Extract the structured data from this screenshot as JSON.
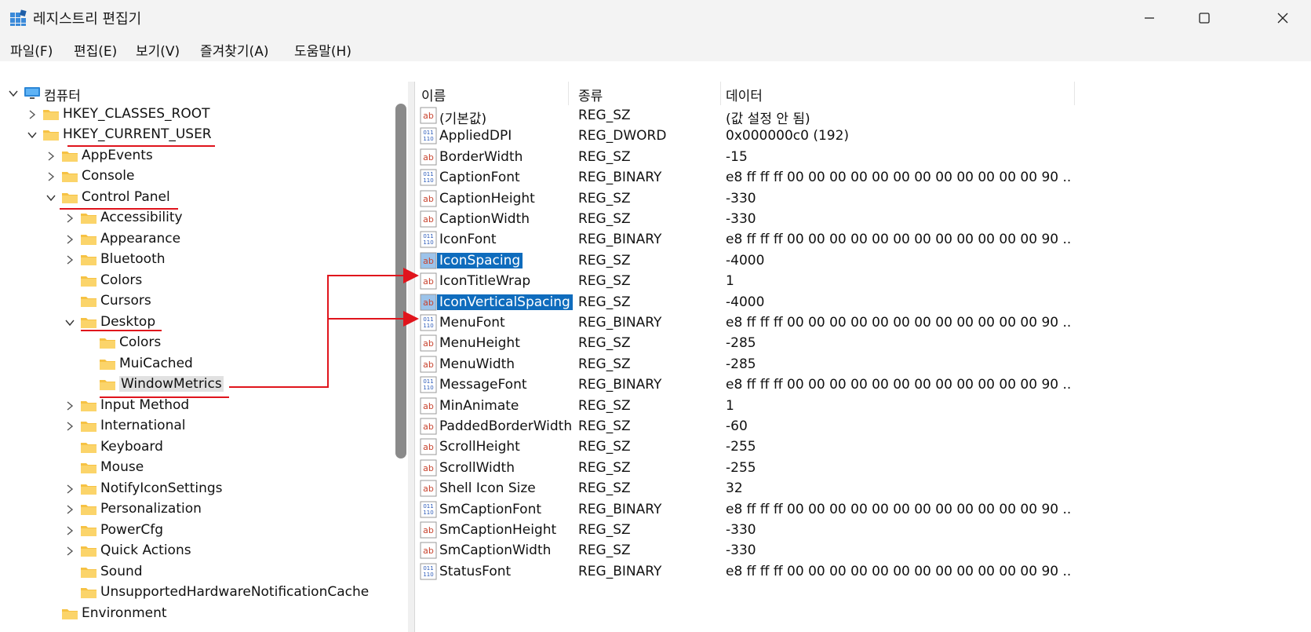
{
  "window": {
    "title": "레지스트리 편집기",
    "controls": {
      "minimize": "minimize",
      "maximize": "maximize",
      "close": "close"
    }
  },
  "menu": [
    "파일(F)",
    "편집(E)",
    "보기(V)",
    "즐겨찾기(A)",
    "도움말(H)"
  ],
  "tree": [
    {
      "label": "컴퓨터",
      "level": 0,
      "expanded": true,
      "icon": "computer-icon"
    },
    {
      "label": "HKEY_CLASSES_ROOT",
      "level": 1,
      "expanded": false
    },
    {
      "label": "HKEY_CURRENT_USER",
      "level": 1,
      "expanded": true
    },
    {
      "label": "AppEvents",
      "level": 2,
      "expanded": false
    },
    {
      "label": "Console",
      "level": 2,
      "expanded": false
    },
    {
      "label": "Control Panel",
      "level": 2,
      "expanded": true
    },
    {
      "label": "Accessibility",
      "level": 3,
      "expanded": false
    },
    {
      "label": "Appearance",
      "level": 3,
      "expanded": false
    },
    {
      "label": "Bluetooth",
      "level": 3,
      "expanded": false
    },
    {
      "label": "Colors",
      "level": 3,
      "leaf": true
    },
    {
      "label": "Cursors",
      "level": 3,
      "leaf": true
    },
    {
      "label": "Desktop",
      "level": 3,
      "expanded": true
    },
    {
      "label": "Colors",
      "level": 4,
      "leaf": true
    },
    {
      "label": "MuiCached",
      "level": 4,
      "leaf": true
    },
    {
      "label": "WindowMetrics",
      "level": 4,
      "leaf": true,
      "selected": true
    },
    {
      "label": "Input Method",
      "level": 3,
      "expanded": false
    },
    {
      "label": "International",
      "level": 3,
      "expanded": false
    },
    {
      "label": "Keyboard",
      "level": 3,
      "leaf": true
    },
    {
      "label": "Mouse",
      "level": 3,
      "leaf": true
    },
    {
      "label": "NotifyIconSettings",
      "level": 3,
      "expanded": false
    },
    {
      "label": "Personalization",
      "level": 3,
      "expanded": false
    },
    {
      "label": "PowerCfg",
      "level": 3,
      "expanded": false
    },
    {
      "label": "Quick Actions",
      "level": 3,
      "expanded": false
    },
    {
      "label": "Sound",
      "level": 3,
      "leaf": true
    },
    {
      "label": "UnsupportedHardwareNotificationCache",
      "level": 3,
      "leaf": true
    },
    {
      "label": "Environment",
      "level": 2,
      "leaf": true
    }
  ],
  "columns": {
    "name": "이름",
    "type": "종류",
    "data": "데이터"
  },
  "values": [
    {
      "name": "(기본값)",
      "type": "REG_SZ",
      "data": "(값 설정 안 됨)",
      "kind": "sz"
    },
    {
      "name": "AppliedDPI",
      "type": "REG_DWORD",
      "data": "0x000000c0 (192)",
      "kind": "bin"
    },
    {
      "name": "BorderWidth",
      "type": "REG_SZ",
      "data": "-15",
      "kind": "sz"
    },
    {
      "name": "CaptionFont",
      "type": "REG_BINARY",
      "data": "e8 ff ff ff 00 00 00 00 00 00 00 00 00 00 00 00 90 ...",
      "kind": "bin"
    },
    {
      "name": "CaptionHeight",
      "type": "REG_SZ",
      "data": "-330",
      "kind": "sz"
    },
    {
      "name": "CaptionWidth",
      "type": "REG_SZ",
      "data": "-330",
      "kind": "sz"
    },
    {
      "name": "IconFont",
      "type": "REG_BINARY",
      "data": "e8 ff ff ff 00 00 00 00 00 00 00 00 00 00 00 00 90 ...",
      "kind": "bin"
    },
    {
      "name": "IconSpacing",
      "type": "REG_SZ",
      "data": "-4000",
      "kind": "sz",
      "selected": true
    },
    {
      "name": "IconTitleWrap",
      "type": "REG_SZ",
      "data": "1",
      "kind": "sz"
    },
    {
      "name": "IconVerticalSpacing",
      "type": "REG_SZ",
      "data": "-4000",
      "kind": "sz",
      "selected": true
    },
    {
      "name": "MenuFont",
      "type": "REG_BINARY",
      "data": "e8 ff ff ff 00 00 00 00 00 00 00 00 00 00 00 00 90 ...",
      "kind": "bin"
    },
    {
      "name": "MenuHeight",
      "type": "REG_SZ",
      "data": "-285",
      "kind": "sz"
    },
    {
      "name": "MenuWidth",
      "type": "REG_SZ",
      "data": "-285",
      "kind": "sz"
    },
    {
      "name": "MessageFont",
      "type": "REG_BINARY",
      "data": "e8 ff ff ff 00 00 00 00 00 00 00 00 00 00 00 00 90 ...",
      "kind": "bin"
    },
    {
      "name": "MinAnimate",
      "type": "REG_SZ",
      "data": "1",
      "kind": "sz"
    },
    {
      "name": "PaddedBorderWidth",
      "type": "REG_SZ",
      "data": "-60",
      "kind": "sz"
    },
    {
      "name": "ScrollHeight",
      "type": "REG_SZ",
      "data": "-255",
      "kind": "sz"
    },
    {
      "name": "ScrollWidth",
      "type": "REG_SZ",
      "data": "-255",
      "kind": "sz"
    },
    {
      "name": "Shell Icon Size",
      "type": "REG_SZ",
      "data": "32",
      "kind": "sz"
    },
    {
      "name": "SmCaptionFont",
      "type": "REG_BINARY",
      "data": "e8 ff ff ff 00 00 00 00 00 00 00 00 00 00 00 00 90 ...",
      "kind": "bin"
    },
    {
      "name": "SmCaptionHeight",
      "type": "REG_SZ",
      "data": "-330",
      "kind": "sz"
    },
    {
      "name": "SmCaptionWidth",
      "type": "REG_SZ",
      "data": "-330",
      "kind": "sz"
    },
    {
      "name": "StatusFont",
      "type": "REG_BINARY",
      "data": "e8 ff ff ff 00 00 00 00 00 00 00 00 00 00 00 00 90 ...",
      "kind": "bin"
    }
  ],
  "colors": {
    "selection": "#0f6cbd",
    "annotation": "#e0141c",
    "folder": "#f6c244"
  }
}
